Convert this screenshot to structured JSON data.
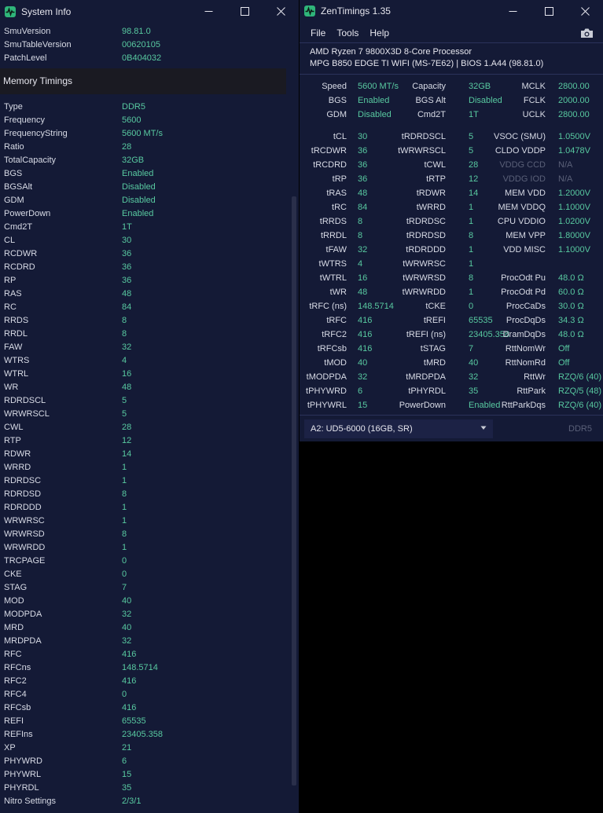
{
  "sysinfo": {
    "title": "System Info",
    "top_rows": [
      {
        "key": "SmuVersion",
        "value": "98.81.0"
      },
      {
        "key": "SmuTableVersion",
        "value": "00620105"
      },
      {
        "key": "PatchLevel",
        "value": "0B404032"
      }
    ],
    "section_title": "Memory Timings",
    "rows": [
      {
        "key": "Type",
        "value": "DDR5"
      },
      {
        "key": "Frequency",
        "value": "5600"
      },
      {
        "key": "FrequencyString",
        "value": "5600 MT/s"
      },
      {
        "key": "Ratio",
        "value": "28"
      },
      {
        "key": "TotalCapacity",
        "value": "32GB"
      },
      {
        "key": "BGS",
        "value": "Enabled"
      },
      {
        "key": "BGSAlt",
        "value": "Disabled"
      },
      {
        "key": "GDM",
        "value": "Disabled"
      },
      {
        "key": "PowerDown",
        "value": "Enabled"
      },
      {
        "key": "Cmd2T",
        "value": "1T"
      },
      {
        "key": "CL",
        "value": "30"
      },
      {
        "key": "RCDWR",
        "value": "36"
      },
      {
        "key": "RCDRD",
        "value": "36"
      },
      {
        "key": "RP",
        "value": "36"
      },
      {
        "key": "RAS",
        "value": "48"
      },
      {
        "key": "RC",
        "value": "84"
      },
      {
        "key": "RRDS",
        "value": "8"
      },
      {
        "key": "RRDL",
        "value": "8"
      },
      {
        "key": "FAW",
        "value": "32"
      },
      {
        "key": "WTRS",
        "value": "4"
      },
      {
        "key": "WTRL",
        "value": "16"
      },
      {
        "key": "WR",
        "value": "48"
      },
      {
        "key": "RDRDSCL",
        "value": "5"
      },
      {
        "key": "WRWRSCL",
        "value": "5"
      },
      {
        "key": "CWL",
        "value": "28"
      },
      {
        "key": "RTP",
        "value": "12"
      },
      {
        "key": "RDWR",
        "value": "14"
      },
      {
        "key": "WRRD",
        "value": "1"
      },
      {
        "key": "RDRDSC",
        "value": "1"
      },
      {
        "key": "RDRDSD",
        "value": "8"
      },
      {
        "key": "RDRDDD",
        "value": "1"
      },
      {
        "key": "WRWRSC",
        "value": "1"
      },
      {
        "key": "WRWRSD",
        "value": "8"
      },
      {
        "key": "WRWRDD",
        "value": "1"
      },
      {
        "key": "TRCPAGE",
        "value": "0"
      },
      {
        "key": "CKE",
        "value": "0"
      },
      {
        "key": "STAG",
        "value": "7"
      },
      {
        "key": "MOD",
        "value": "40"
      },
      {
        "key": "MODPDA",
        "value": "32"
      },
      {
        "key": "MRD",
        "value": "40"
      },
      {
        "key": "MRDPDA",
        "value": "32"
      },
      {
        "key": "RFC",
        "value": "416"
      },
      {
        "key": "RFCns",
        "value": "148.5714"
      },
      {
        "key": "RFC2",
        "value": "416"
      },
      {
        "key": "RFC4",
        "value": "0"
      },
      {
        "key": "RFCsb",
        "value": "416"
      },
      {
        "key": "REFI",
        "value": "65535"
      },
      {
        "key": "REFIns",
        "value": "23405.358"
      },
      {
        "key": "XP",
        "value": "21"
      },
      {
        "key": "PHYWRD",
        "value": "6"
      },
      {
        "key": "PHYWRL",
        "value": "15"
      },
      {
        "key": "PHYRDL",
        "value": "35"
      },
      {
        "key": "Nitro Settings",
        "value": "2/3/1"
      }
    ]
  },
  "zen": {
    "title": "ZenTimings 1.35",
    "menu": {
      "file": "File",
      "tools": "Tools",
      "help": "Help"
    },
    "cpu": "AMD Ryzen 7 9800X3D 8-Core Processor",
    "board": "MPG B850 EDGE TI WIFI (MS-7E62) | BIOS 1.A44 (98.81.0)",
    "top": [
      [
        {
          "l": "Speed",
          "v": "5600 MT/s"
        },
        {
          "l": "Capacity",
          "v": "32GB"
        },
        {
          "l": "MCLK",
          "v": "2800.00"
        }
      ],
      [
        {
          "l": "BGS",
          "v": "Enabled"
        },
        {
          "l": "BGS Alt",
          "v": "Disabled"
        },
        {
          "l": "FCLK",
          "v": "2000.00"
        }
      ],
      [
        {
          "l": "GDM",
          "v": "Disabled"
        },
        {
          "l": "Cmd2T",
          "v": "1T"
        },
        {
          "l": "UCLK",
          "v": "2800.00"
        }
      ]
    ],
    "timings": [
      [
        {
          "l": "tCL",
          "v": "30"
        },
        {
          "l": "tRDRDSCL",
          "v": "5"
        },
        {
          "l": "VSOC (SMU)",
          "v": "1.0500V"
        }
      ],
      [
        {
          "l": "tRCDWR",
          "v": "36"
        },
        {
          "l": "tWRWRSCL",
          "v": "5"
        },
        {
          "l": "CLDO VDDP",
          "v": "1.0478V"
        }
      ],
      [
        {
          "l": "tRCDRD",
          "v": "36"
        },
        {
          "l": "tCWL",
          "v": "28"
        },
        {
          "l": "VDDG CCD",
          "v": "N/A",
          "dim": true
        }
      ],
      [
        {
          "l": "tRP",
          "v": "36"
        },
        {
          "l": "tRTP",
          "v": "12"
        },
        {
          "l": "VDDG IOD",
          "v": "N/A",
          "dim": true
        }
      ],
      [
        {
          "l": "tRAS",
          "v": "48"
        },
        {
          "l": "tRDWR",
          "v": "14"
        },
        {
          "l": "MEM VDD",
          "v": "1.2000V"
        }
      ],
      [
        {
          "l": "tRC",
          "v": "84"
        },
        {
          "l": "tWRRD",
          "v": "1"
        },
        {
          "l": "MEM VDDQ",
          "v": "1.1000V"
        }
      ],
      [
        {
          "l": "tRRDS",
          "v": "8"
        },
        {
          "l": "tRDRDSC",
          "v": "1"
        },
        {
          "l": "CPU VDDIO",
          "v": "1.0200V"
        }
      ],
      [
        {
          "l": "tRRDL",
          "v": "8"
        },
        {
          "l": "tRDRDSD",
          "v": "8"
        },
        {
          "l": "MEM VPP",
          "v": "1.8000V"
        }
      ],
      [
        {
          "l": "tFAW",
          "v": "32"
        },
        {
          "l": "tRDRDDD",
          "v": "1"
        },
        {
          "l": "VDD MISC",
          "v": "1.1000V"
        }
      ],
      [
        {
          "l": "tWTRS",
          "v": "4"
        },
        {
          "l": "tWRWRSC",
          "v": "1"
        },
        {
          "l": "",
          "v": ""
        }
      ],
      [
        {
          "l": "tWTRL",
          "v": "16"
        },
        {
          "l": "tWRWRSD",
          "v": "8"
        },
        {
          "l": "ProcOdt Pu",
          "v": "48.0 Ω"
        }
      ],
      [
        {
          "l": "tWR",
          "v": "48"
        },
        {
          "l": "tWRWRDD",
          "v": "1"
        },
        {
          "l": "ProcOdt Pd",
          "v": "60.0 Ω"
        }
      ],
      [
        {
          "l": "tRFC (ns)",
          "v": "148.5714"
        },
        {
          "l": "tCKE",
          "v": "0"
        },
        {
          "l": "ProcCaDs",
          "v": "30.0 Ω"
        }
      ],
      [
        {
          "l": "tRFC",
          "v": "416"
        },
        {
          "l": "tREFI",
          "v": "65535"
        },
        {
          "l": "ProcDqDs",
          "v": "34.3 Ω"
        }
      ],
      [
        {
          "l": "tRFC2",
          "v": "416"
        },
        {
          "l": "tREFI (ns)",
          "v": "23405.358"
        },
        {
          "l": "DramDqDs",
          "v": "48.0 Ω"
        }
      ],
      [
        {
          "l": "tRFCsb",
          "v": "416"
        },
        {
          "l": "tSTAG",
          "v": "7"
        },
        {
          "l": "RttNomWr",
          "v": "Off"
        }
      ],
      [
        {
          "l": "tMOD",
          "v": "40"
        },
        {
          "l": "tMRD",
          "v": "40"
        },
        {
          "l": "RttNomRd",
          "v": "Off"
        }
      ],
      [
        {
          "l": "tMODPDA",
          "v": "32"
        },
        {
          "l": "tMRDPDA",
          "v": "32"
        },
        {
          "l": "RttWr",
          "v": "RZQ/6 (40)"
        }
      ],
      [
        {
          "l": "tPHYWRD",
          "v": "6"
        },
        {
          "l": "tPHYRDL",
          "v": "35"
        },
        {
          "l": "RttPark",
          "v": "RZQ/5 (48)"
        }
      ],
      [
        {
          "l": "tPHYWRL",
          "v": "15"
        },
        {
          "l": "PowerDown",
          "v": "Enabled"
        },
        {
          "l": "RttParkDqs",
          "v": "RZQ/6 (40)"
        }
      ]
    ],
    "dimm_selected": "A2: UD5-6000 (16GB, SR)",
    "dimm_type": "DDR5"
  },
  "colors": {
    "accent_green": "#58c9a0",
    "window_bg": "#141a36",
    "dim_text": "#5a6078"
  }
}
